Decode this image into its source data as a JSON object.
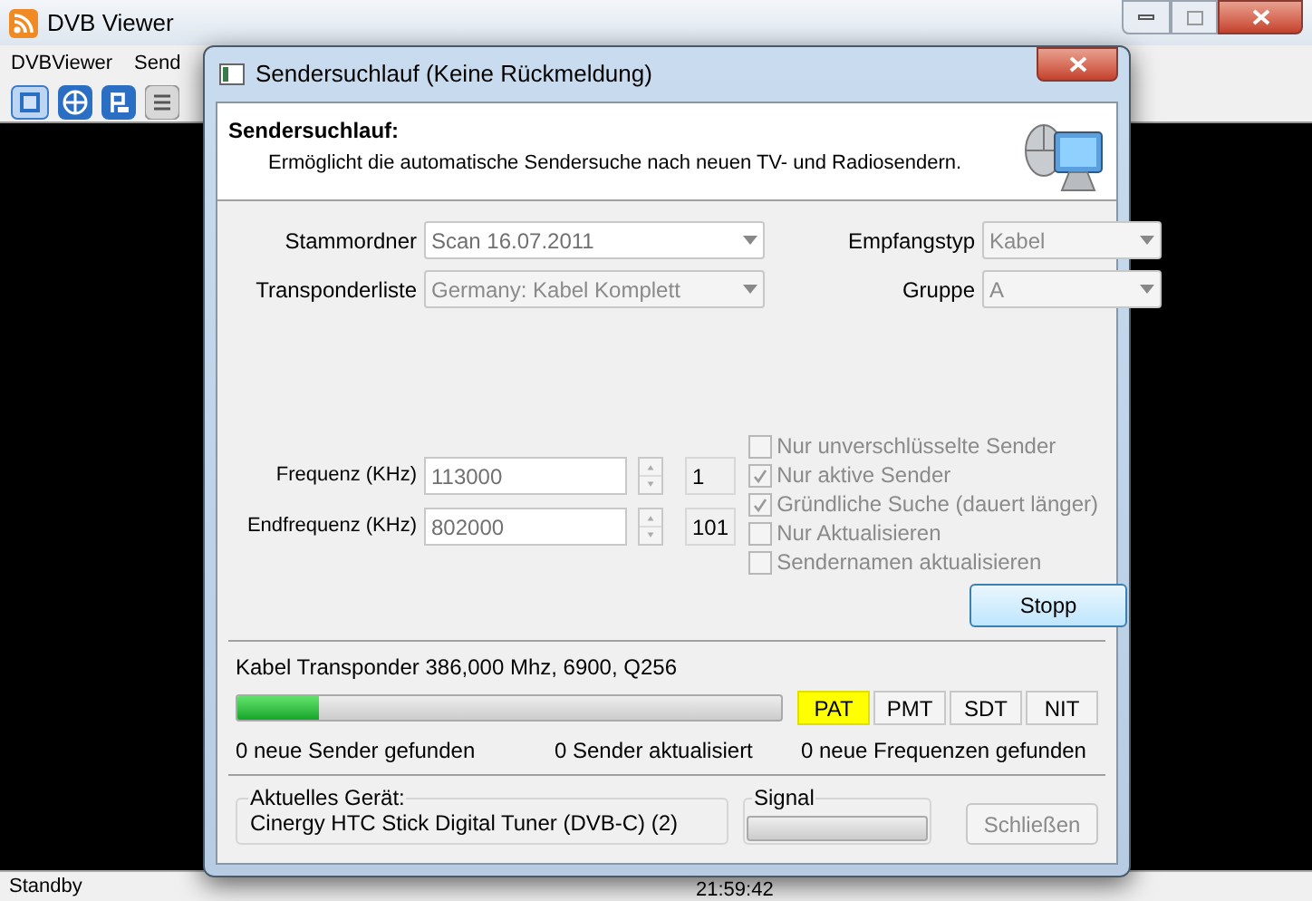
{
  "main_window": {
    "title": "DVB Viewer",
    "menu": [
      {
        "label": "DVBViewer"
      },
      {
        "label": "Send"
      }
    ],
    "status_bar": {
      "state": "Standby",
      "time": "21:59:42"
    }
  },
  "dialog": {
    "title": "Sendersuchlauf (Keine Rückmeldung)",
    "header": {
      "title": "Sendersuchlauf:",
      "description": "Ermöglicht die automatische Sendersuche nach neuen TV- und Radiosendern."
    },
    "dropdowns": [
      {
        "label": "Stammordner",
        "value": "Scan 16.07.2011",
        "disabled": false
      },
      {
        "label": "Empfangstyp",
        "value": "Kabel",
        "disabled": true
      },
      {
        "label": "Transponderliste",
        "value": "Germany: Kabel Komplett",
        "disabled": true
      },
      {
        "label": "Gruppe",
        "value": "A",
        "disabled": true
      }
    ],
    "frequencies": [
      {
        "label": "Frequenz (KHz)",
        "value": "113000",
        "count": "1"
      },
      {
        "label": "Endfrequenz (KHz)",
        "value": "802000",
        "count": "101"
      }
    ],
    "options": [
      {
        "label": "Nur unverschlüsselte Sender",
        "checked": false
      },
      {
        "label": "Nur aktive Sender",
        "checked": true
      },
      {
        "label": "Gründliche Suche (dauert länger)",
        "checked": true
      },
      {
        "label": "Nur Aktualisieren",
        "checked": false
      },
      {
        "label": "Sendernamen aktualisieren",
        "checked": false
      }
    ],
    "stop_button": "Stopp",
    "transponder": "Kabel Transponder 386,000 Mhz, 6900, Q256",
    "progress": {
      "level": 0.15
    },
    "tables": [
      {
        "label": "PAT",
        "selected": true
      },
      {
        "label": "PMT",
        "selected": false
      },
      {
        "label": "SDT",
        "selected": false
      },
      {
        "label": "NIT",
        "selected": false
      }
    ],
    "counters": [
      "0 neue Sender gefunden",
      "0 Sender aktualisiert",
      "0 neue Frequenzen gefunden"
    ],
    "device": {
      "label": "Aktuelles Gerät:",
      "name": "Cinergy HTC Stick Digital Tuner (DVB-C) (2)"
    },
    "signal": {
      "label": "Signal",
      "level": 0
    },
    "close_button": {
      "label": "Schließen",
      "disabled": true
    }
  }
}
